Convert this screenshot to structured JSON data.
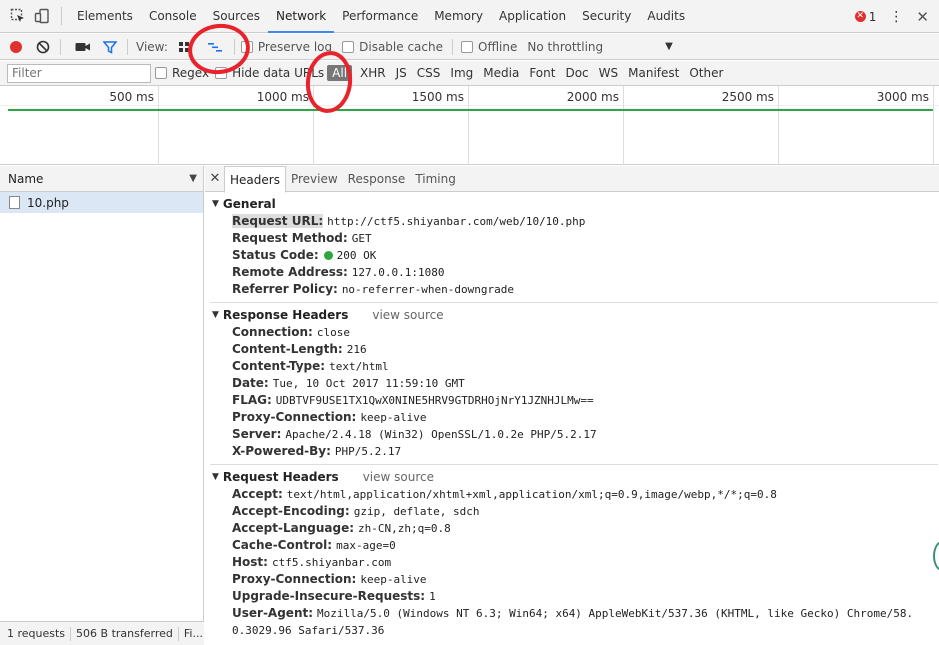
{
  "tabs": [
    {
      "label": "Elements"
    },
    {
      "label": "Console"
    },
    {
      "label": "Sources"
    },
    {
      "label": "Network"
    },
    {
      "label": "Performance"
    },
    {
      "label": "Memory"
    },
    {
      "label": "Application"
    },
    {
      "label": "Security"
    },
    {
      "label": "Audits"
    }
  ],
  "error_count": "1",
  "toolbar": {
    "view_label": "View:",
    "preserve_log": "Preserve log",
    "disable_cache": "Disable cache",
    "offline": "Offline",
    "throttling": "No throttling"
  },
  "filter": {
    "placeholder": "Filter",
    "regex": "Regex",
    "hide_data_urls": "Hide data URLs",
    "types": [
      "All",
      "XHR",
      "JS",
      "CSS",
      "Img",
      "Media",
      "Font",
      "Doc",
      "WS",
      "Manifest",
      "Other"
    ]
  },
  "timeline": {
    "ticks": [
      "500 ms",
      "1000 ms",
      "1500 ms",
      "2000 ms",
      "2500 ms",
      "3000 ms"
    ]
  },
  "request_list": {
    "header": "Name",
    "rows": [
      {
        "name": "10.php"
      }
    ],
    "footer": {
      "requests": "1 requests",
      "transferred": "506 B transferred",
      "finish": "Fi..."
    }
  },
  "detail": {
    "tabs": [
      "Headers",
      "Preview",
      "Response",
      "Timing"
    ],
    "general": {
      "title": "General",
      "rows": [
        {
          "key": "Request URL:",
          "value": "http://ctf5.shiyanbar.com/web/10/10.php"
        },
        {
          "key": "Request Method:",
          "value": "GET"
        },
        {
          "key": "Status Code:",
          "value": "200 OK"
        },
        {
          "key": "Remote Address:",
          "value": "127.0.0.1:1080"
        },
        {
          "key": "Referrer Policy:",
          "value": "no-referrer-when-downgrade"
        }
      ]
    },
    "response_headers": {
      "title": "Response Headers",
      "view_source": "view source",
      "rows": [
        {
          "key": "Connection:",
          "value": "close"
        },
        {
          "key": "Content-Length:",
          "value": "216"
        },
        {
          "key": "Content-Type:",
          "value": "text/html"
        },
        {
          "key": "Date:",
          "value": "Tue, 10 Oct 2017 11:59:10 GMT"
        },
        {
          "key": "FLAG:",
          "value": "UDBTVF9USE1TX1QwX0NINE5HRV9GTDRHOjNrY1JZNHJLMw=="
        },
        {
          "key": "Proxy-Connection:",
          "value": "keep-alive"
        },
        {
          "key": "Server:",
          "value": "Apache/2.4.18 (Win32) OpenSSL/1.0.2e PHP/5.2.17"
        },
        {
          "key": "X-Powered-By:",
          "value": "PHP/5.2.17"
        }
      ]
    },
    "request_headers": {
      "title": "Request Headers",
      "view_source": "view source",
      "rows": [
        {
          "key": "Accept:",
          "value": "text/html,application/xhtml+xml,application/xml;q=0.9,image/webp,*/*;q=0.8"
        },
        {
          "key": "Accept-Encoding:",
          "value": "gzip, deflate, sdch"
        },
        {
          "key": "Accept-Language:",
          "value": "zh-CN,zh;q=0.8"
        },
        {
          "key": "Cache-Control:",
          "value": "max-age=0"
        },
        {
          "key": "Host:",
          "value": "ctf5.shiyanbar.com"
        },
        {
          "key": "Proxy-Connection:",
          "value": "keep-alive"
        },
        {
          "key": "Upgrade-Insecure-Requests:",
          "value": "1"
        },
        {
          "key": "User-Agent:",
          "value": "Mozilla/5.0 (Windows NT 6.3; Win64; x64) AppleWebKit/537.36 (KHTML, like Gecko) Chrome/58.0.3029.96 Safari/537.36"
        }
      ]
    }
  },
  "colors": {
    "accent": "#4285f4",
    "record": "#e0312e",
    "status_ok": "#2ea63b",
    "annotation": "#e8232b"
  }
}
